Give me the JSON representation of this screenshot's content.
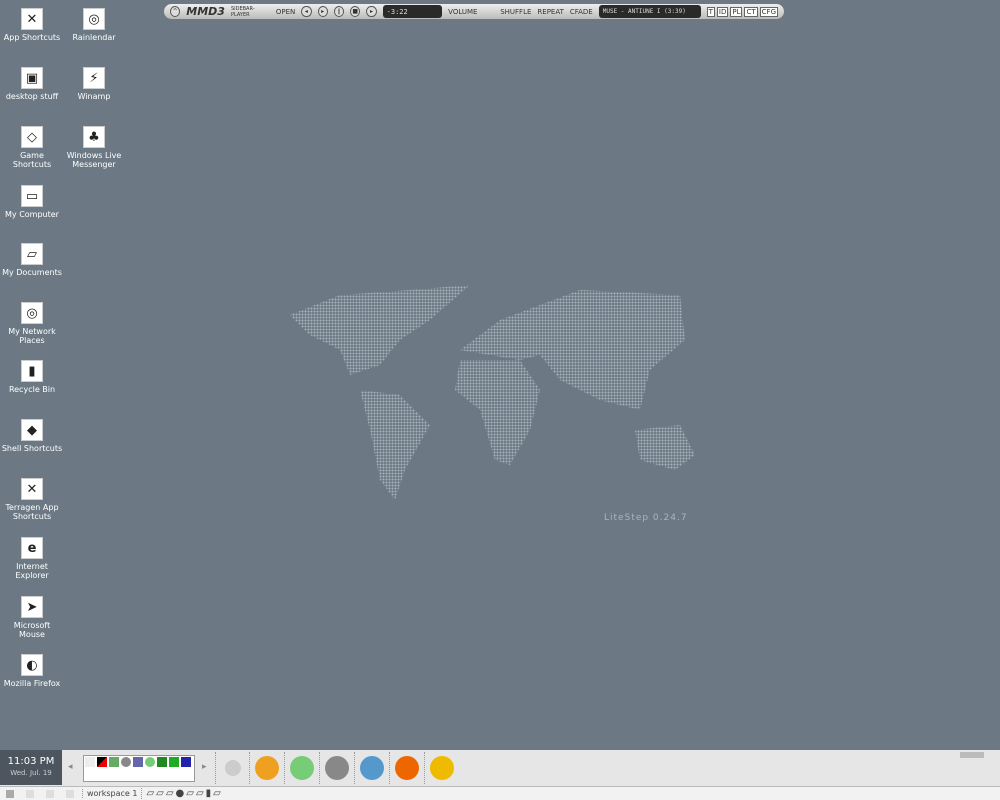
{
  "desktop_icons": [
    {
      "label": "App Shortcuts",
      "glyph": "✕"
    },
    {
      "label": "desktop stuff",
      "glyph": "▣"
    },
    {
      "label": "Game Shortcuts",
      "glyph": "◇"
    },
    {
      "label": "My Computer",
      "glyph": "▭"
    },
    {
      "label": "My Documents",
      "glyph": "▱"
    },
    {
      "label": "My Network Places",
      "glyph": "◎"
    },
    {
      "label": "Recycle Bin",
      "glyph": "▮"
    },
    {
      "label": "Shell Shortcuts",
      "glyph": "◆"
    },
    {
      "label": "Terragen App Shortcuts",
      "glyph": "✕"
    },
    {
      "label": "Internet Explorer",
      "glyph": "e"
    },
    {
      "label": "Microsoft Mouse",
      "glyph": "➤"
    },
    {
      "label": "Mozilla Firefox",
      "glyph": "◐"
    },
    {
      "label": "Rainlendar",
      "glyph": "◎"
    },
    {
      "label": "Winamp",
      "glyph": "⚡"
    },
    {
      "label": "Windows Live Messenger",
      "glyph": "♣"
    }
  ],
  "player": {
    "logo": "MMD3",
    "sublogo": "SIDEBAR-PLAYER",
    "open": "OPEN",
    "time": "-3:22",
    "volume": "VOLUME",
    "shuffle": "SHUFFLE",
    "repeat": "REPEAT",
    "cfade": "CFADE",
    "track": "MUSE - ANTIUNE I (3:39)",
    "tabs": [
      "T",
      "ID",
      "PL",
      "CT",
      "CFG"
    ]
  },
  "wallpaper": {
    "brand": "LiteStep 0.24.7"
  },
  "taskbar": {
    "time": "11:03 PM",
    "date": "Wed. Jul. 19",
    "workspace": "workspace 1",
    "quicklaunch": [
      {
        "name": "winamp",
        "color": "#f0a020"
      },
      {
        "name": "messenger-chat",
        "color": "#7c7"
      },
      {
        "name": "system-monitor",
        "color": "#888"
      },
      {
        "name": "messenger",
        "color": "#59c"
      },
      {
        "name": "firefox",
        "color": "#e60"
      },
      {
        "name": "sw",
        "color": "#eb0"
      }
    ]
  }
}
